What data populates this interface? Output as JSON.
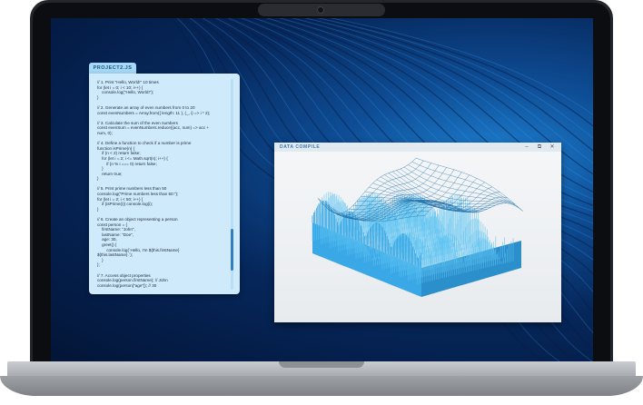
{
  "code_window": {
    "tab_label": "PROJECT2.JS",
    "lines": [
      "// 1. Print \"Hello, World!\" 10 times",
      "for (let i = 0; i < 10; i++) {",
      "    console.log(\"Hello, World!\");",
      "}",
      "",
      "// 2. Generate an array of even numbers from 0 to 20",
      "const evenNumbers = Array.from({ length: 11 }, (_, i) => i * 2);",
      "",
      "// 3. Calculate the sum of the even numbers",
      "const evenSum = evenNumbers.reduce((acc, num) => acc +",
      "num, 0);",
      "",
      "// 4. Define a function to check if a number is prime",
      "function isPrime(n) {",
      "    if (n < 2) return false;",
      "    for (let i = 2; i <= Math.sqrt(n); i++) {",
      "        if (n % i === 0) return false;",
      "    }",
      "    return true;",
      "}",
      "",
      "// 5. Print prime numbers less than 50",
      "console.log(\"Prime numbers less than 50:\");",
      "for (let i = 2; i < 50; i++) {",
      "    if (isPrime(i)) console.log(i);",
      "}",
      "",
      "// 6. Create an object representing a person",
      "const person = {",
      "    firstName: \"John\",",
      "    lastName: \"Doe\",",
      "    age: 30,",
      "    greet() {",
      "        console.log(`Hello, I'm ${this.firstName}",
      "${this.lastName}.`);",
      "    }",
      "};",
      "",
      "// 7. Access object properties",
      "console.log(person.firstName); // John",
      "console.log(person[\"age\"]); // 30"
    ]
  },
  "data_window": {
    "title": "DATA COMPILE",
    "minimize_icon": "minimize-icon",
    "maximize_icon": "maximize-icon",
    "close_icon": "close-icon"
  },
  "colors": {
    "wallpaper_deep": "#031537",
    "wallpaper_bright": "#1d7fd0",
    "code_bg": "#cfeafb",
    "chart_blue": "#2fa3e0"
  }
}
